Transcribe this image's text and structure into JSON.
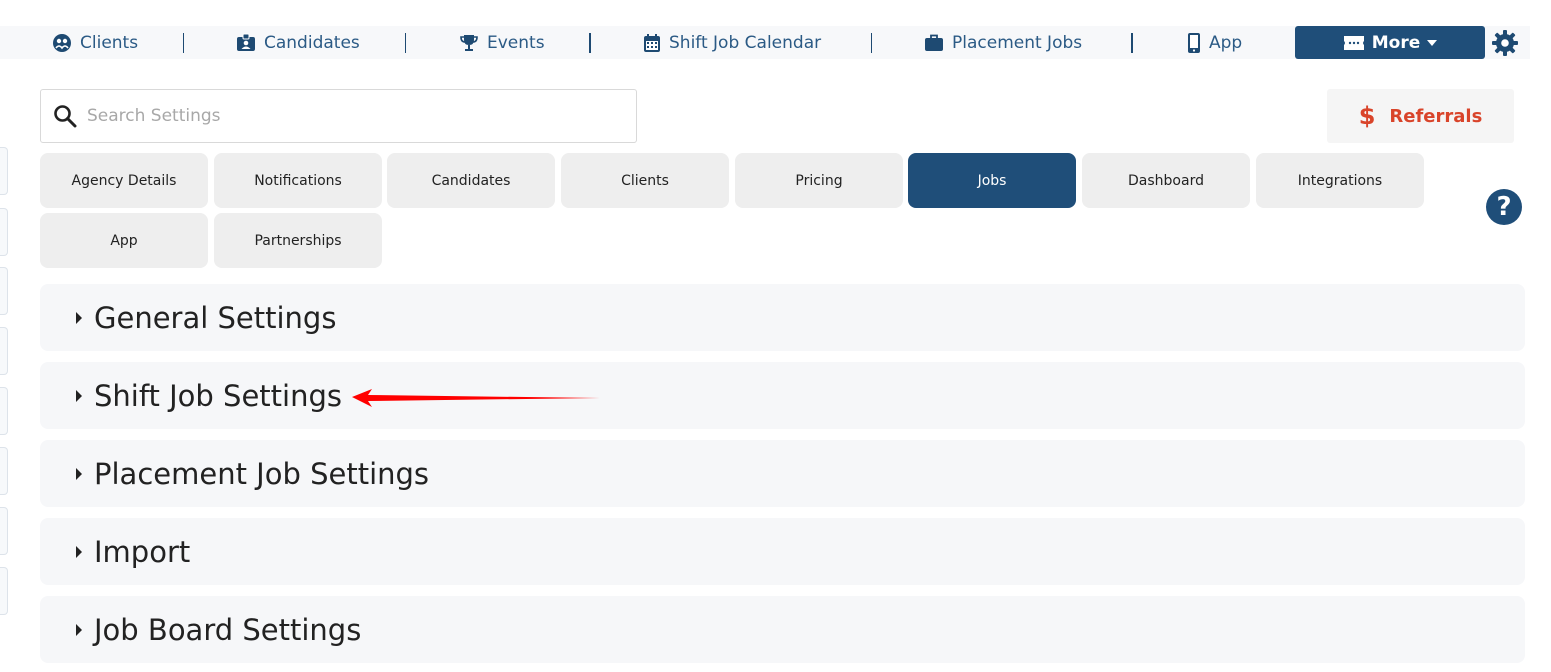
{
  "nav": {
    "items": [
      {
        "label": "Clients",
        "icon": "clients-icon"
      },
      {
        "label": "Candidates",
        "icon": "id-card-icon"
      },
      {
        "label": "Events",
        "icon": "trophy-icon"
      },
      {
        "label": "Shift Job Calendar",
        "icon": "calendar-icon"
      },
      {
        "label": "Placement Jobs",
        "icon": "briefcase-icon"
      },
      {
        "label": "App",
        "icon": "phone-icon"
      }
    ],
    "more_label": "More",
    "more_icon": "ticket-icon",
    "settings_icon": "gear-icon"
  },
  "search": {
    "placeholder": "Search Settings"
  },
  "referrals": {
    "symbol": "$",
    "label": "Referrals"
  },
  "tabs": [
    {
      "label": "Agency Details"
    },
    {
      "label": "Notifications"
    },
    {
      "label": "Candidates"
    },
    {
      "label": "Clients"
    },
    {
      "label": "Pricing"
    },
    {
      "label": "Jobs",
      "active": true
    },
    {
      "label": "Dashboard"
    },
    {
      "label": "Integrations"
    },
    {
      "label": "App"
    },
    {
      "label": "Partnerships"
    }
  ],
  "help": {
    "symbol": "?"
  },
  "sections": [
    {
      "title": "General Settings"
    },
    {
      "title": "Shift Job Settings"
    },
    {
      "title": "Placement Job Settings"
    },
    {
      "title": "Import"
    },
    {
      "title": "Job Board Settings"
    }
  ],
  "colors": {
    "primary": "#1f4e79",
    "accent": "#d9442a",
    "annotation": "#ff0000"
  }
}
